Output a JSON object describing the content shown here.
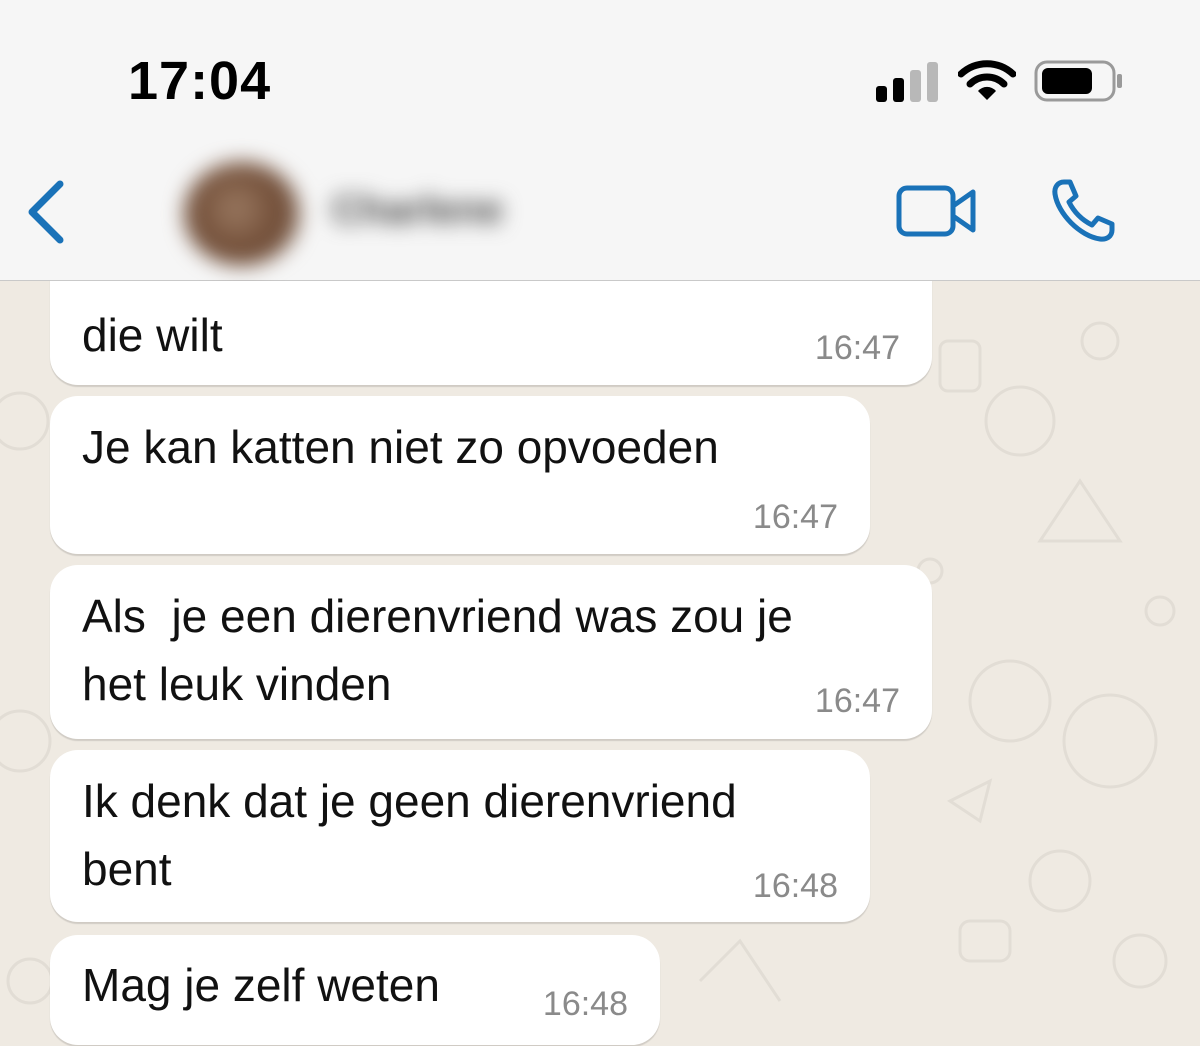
{
  "status_bar": {
    "time": "17:04"
  },
  "header": {
    "contact_name": "Charlene"
  },
  "colors": {
    "accent": "#1a72b8",
    "bubble": "#ffffff",
    "wallpaper": "#efeae2"
  },
  "icons": {
    "back": "chevron-left-icon",
    "video": "video-camera-icon",
    "call": "phone-icon"
  },
  "messages": [
    {
      "text": "die wilt",
      "time": "16:47"
    },
    {
      "text": "Je kan katten niet zo opvoeden",
      "time": "16:47"
    },
    {
      "text": "Als  je een dierenvriend was zou je\nhet leuk vinden",
      "time": "16:47"
    },
    {
      "text": "Ik denk dat je geen dierenvriend\nbent",
      "time": "16:48"
    },
    {
      "text": "Mag je zelf weten",
      "time": "16:48"
    }
  ]
}
